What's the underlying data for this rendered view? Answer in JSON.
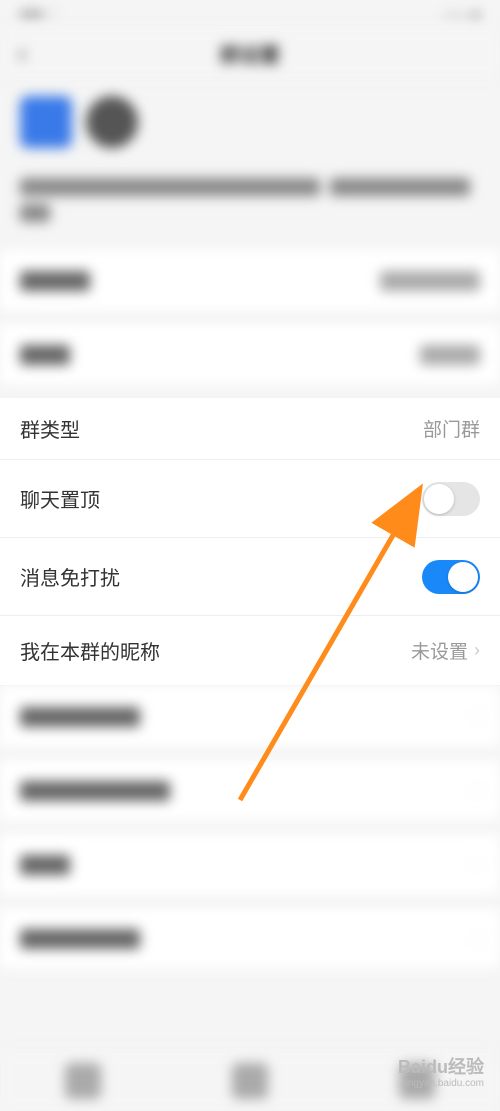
{
  "statusBar": {
    "left": "●●● ⋮",
    "right": "—— ●"
  },
  "header": {
    "backIcon": "‹",
    "title": "群设置"
  },
  "rows": {
    "groupType": {
      "label": "群类型",
      "value": "部门群"
    },
    "pinChat": {
      "label": "聊天置顶",
      "toggle": false
    },
    "dnd": {
      "label": "消息免打扰",
      "toggle": true
    },
    "nickname": {
      "label": "我在本群的昵称",
      "value": "未设置"
    }
  },
  "watermark": {
    "main": "Baidu经验",
    "sub": "jingyan.baidu.com"
  },
  "colors": {
    "accent": "#1989fa",
    "arrow": "#ff8c1a"
  }
}
